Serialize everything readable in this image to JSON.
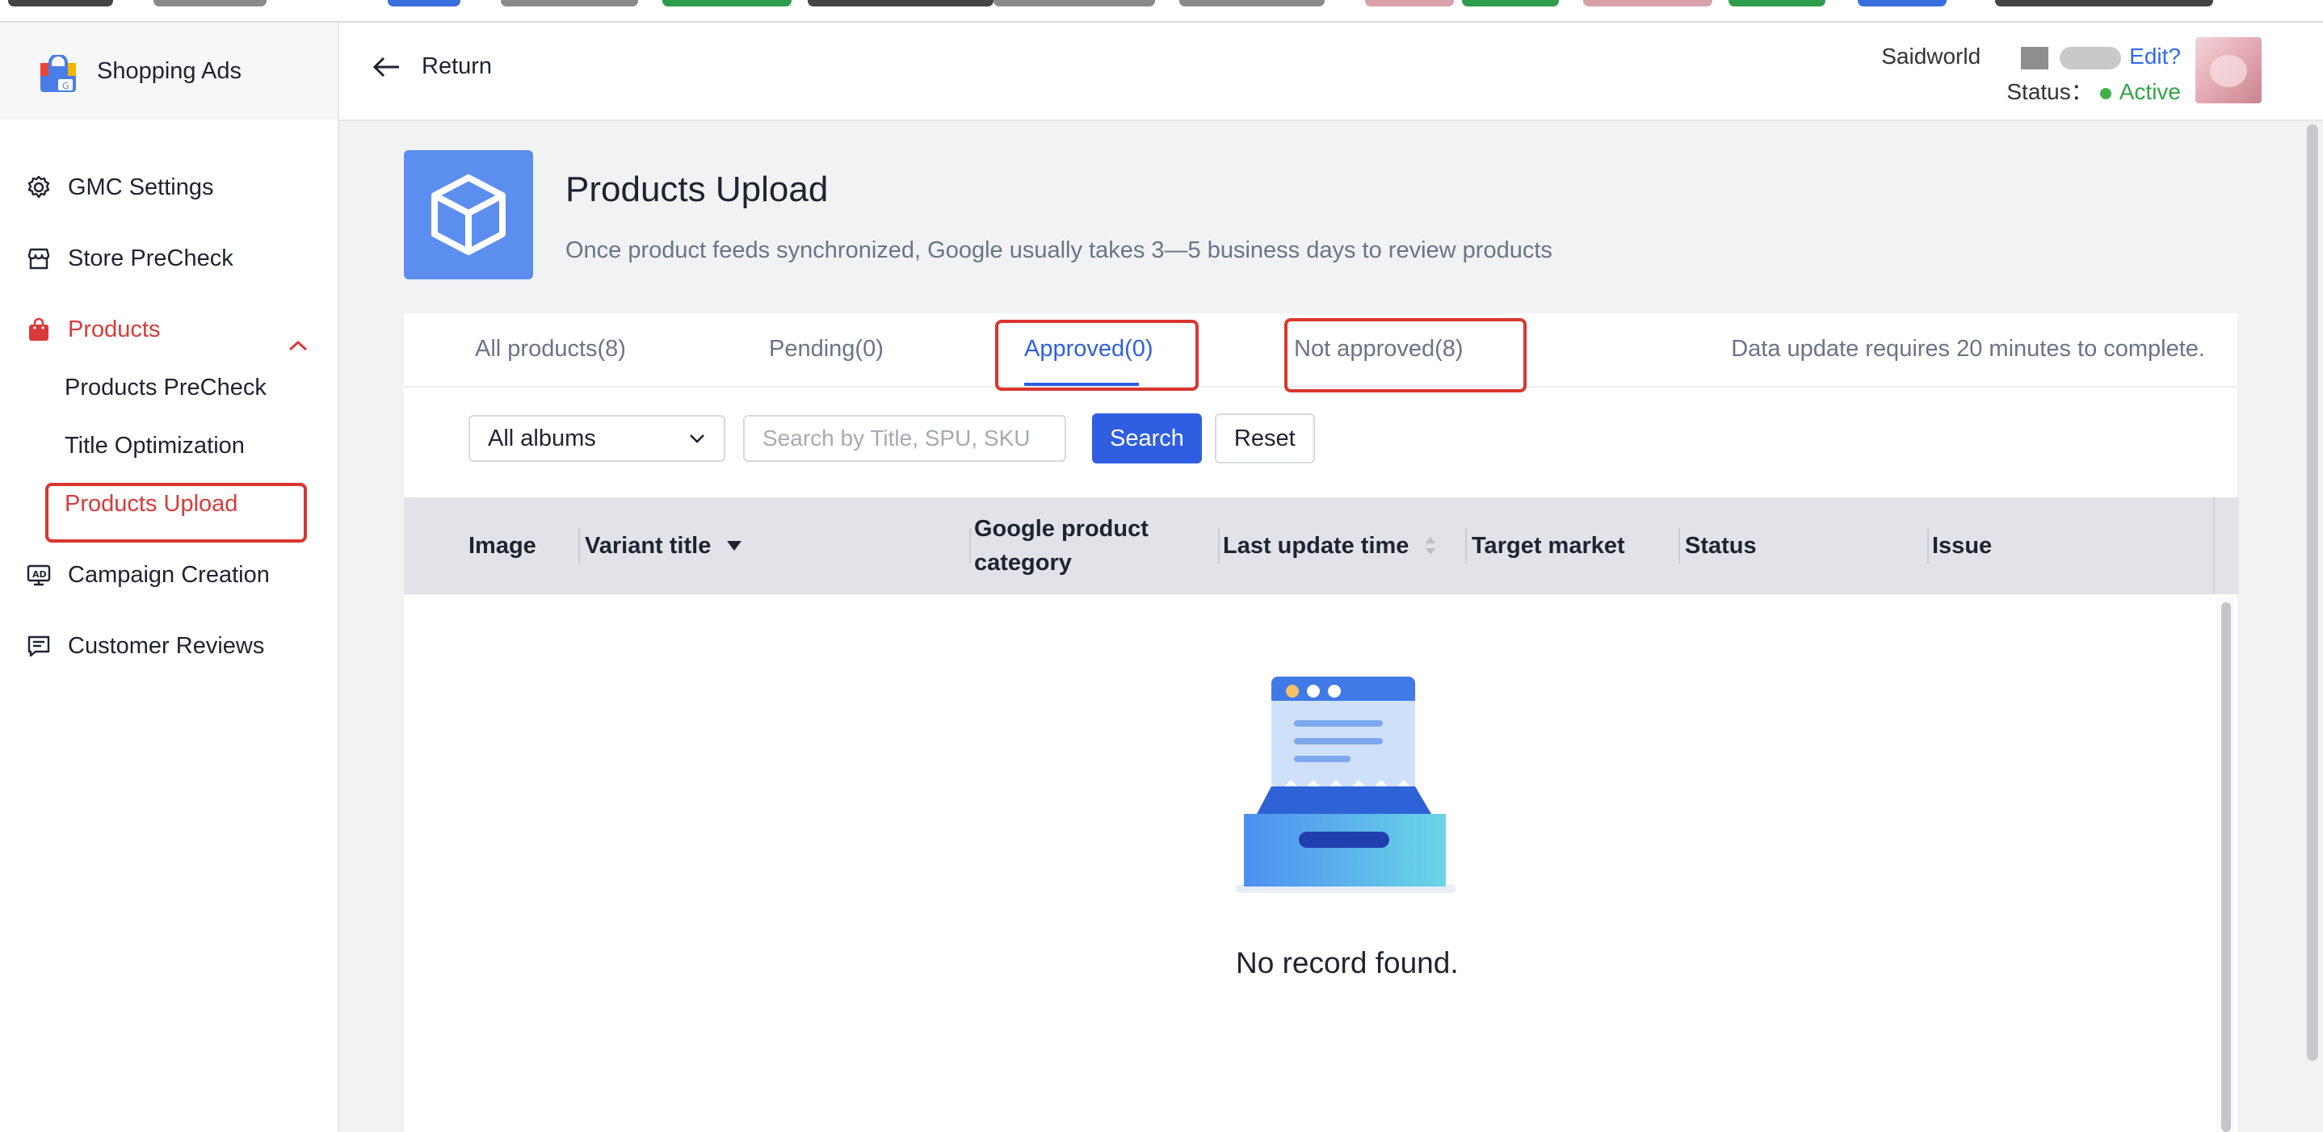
{
  "brand": {
    "name": "Shopping Ads"
  },
  "sidebar": {
    "items": [
      {
        "label": "GMC Settings"
      },
      {
        "label": "Store PreCheck"
      },
      {
        "label": "Products"
      },
      {
        "label": "Campaign Creation"
      },
      {
        "label": "Customer Reviews"
      }
    ],
    "sub_items": [
      {
        "label": "Products PreCheck"
      },
      {
        "label": "Title Optimization"
      },
      {
        "label": "Products Upload"
      }
    ]
  },
  "header": {
    "return_label": "Return",
    "account_name": "Saidworld",
    "edit_label": "Edit?",
    "status_label": "Status：",
    "status_value": "Active"
  },
  "page": {
    "title": "Products Upload",
    "subtitle": "Once product feeds synchronized, Google usually takes 3—5 business days to review products"
  },
  "tabs": [
    {
      "label": "All products(8)"
    },
    {
      "label": "Pending(0)"
    },
    {
      "label": "Approved(0)"
    },
    {
      "label": "Not approved(8)"
    }
  ],
  "note": "Data update requires 20 minutes to complete.",
  "filters": {
    "album_selected": "All albums",
    "search_placeholder": "Search by Title, SPU, SKU",
    "search_label": "Search",
    "reset_label": "Reset"
  },
  "table": {
    "columns": [
      "Image",
      "Variant title",
      "Google product category",
      "Last update time",
      "Target market",
      "Status",
      "Issue"
    ],
    "empty_text": "No record found."
  },
  "colors": {
    "accent": "#2f5fe0",
    "active_nav": "#d93a3a",
    "status_active": "#2fa544",
    "annotation": "#d9362e"
  }
}
